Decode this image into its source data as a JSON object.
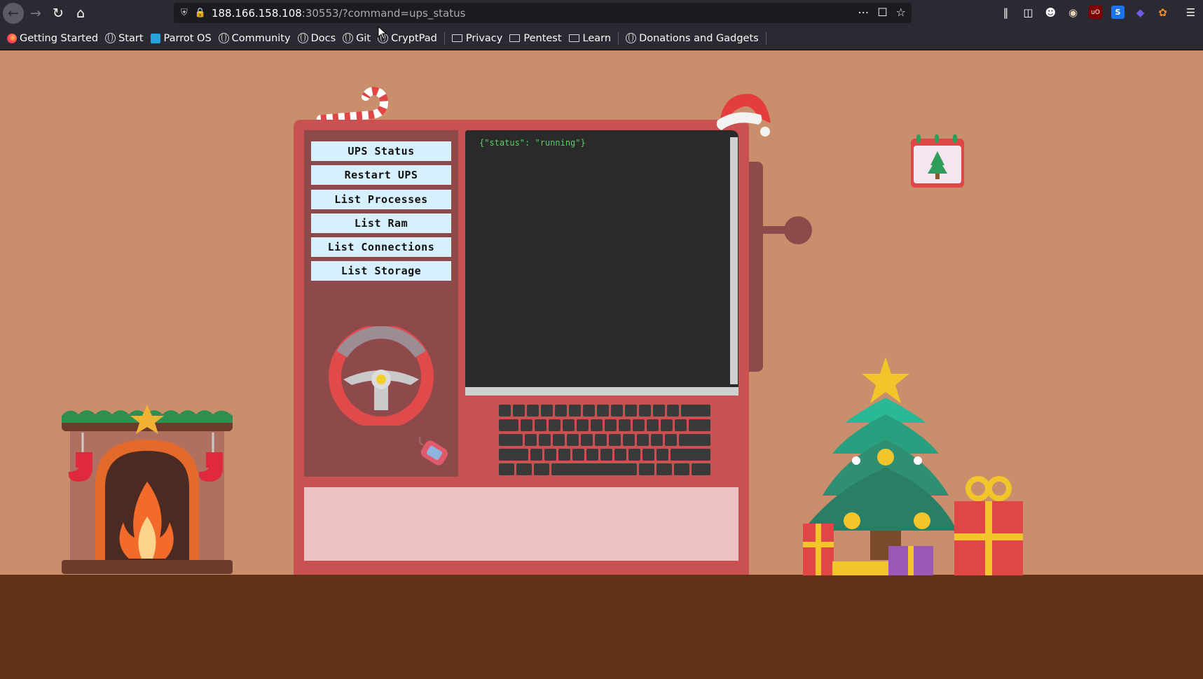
{
  "browser": {
    "url_host": "188.166.158.108",
    "url_rest": ":30553/?command=ups_status",
    "colors": {
      "toolbar": "#2b2a33",
      "urlbar": "#1c1b22"
    }
  },
  "bookmarks": [
    {
      "label": "Getting Started",
      "icon": "firefox-icon"
    },
    {
      "label": "Start",
      "icon": "globe-icon"
    },
    {
      "label": "Parrot OS",
      "icon": "parrot-icon"
    },
    {
      "label": "Community",
      "icon": "globe-icon"
    },
    {
      "label": "Docs",
      "icon": "globe-icon"
    },
    {
      "label": "Git",
      "icon": "globe-icon"
    },
    {
      "label": "CryptPad",
      "icon": "globe-icon"
    },
    {
      "label": "Privacy",
      "icon": "folder-icon"
    },
    {
      "label": "Pentest",
      "icon": "folder-icon"
    },
    {
      "label": "Learn",
      "icon": "folder-icon"
    },
    {
      "label": "Donations and Gadgets",
      "icon": "globe-icon"
    }
  ],
  "menu": [
    {
      "label": "UPS Status"
    },
    {
      "label": "Restart UPS"
    },
    {
      "label": "List Processes"
    },
    {
      "label": "List Ram"
    },
    {
      "label": "List Connections"
    },
    {
      "label": "List Storage"
    }
  ],
  "terminal": {
    "output": "{\"status\": \"running\"}"
  },
  "colors": {
    "wall": "#c98e6b",
    "floor": "#623116",
    "machine": "#c95152",
    "panel": "#8e4a4b",
    "screen": "#2a2a2a",
    "output_text": "#56d364",
    "button": "#d6f0fd",
    "bottom_panel": "#ecc2c4"
  }
}
